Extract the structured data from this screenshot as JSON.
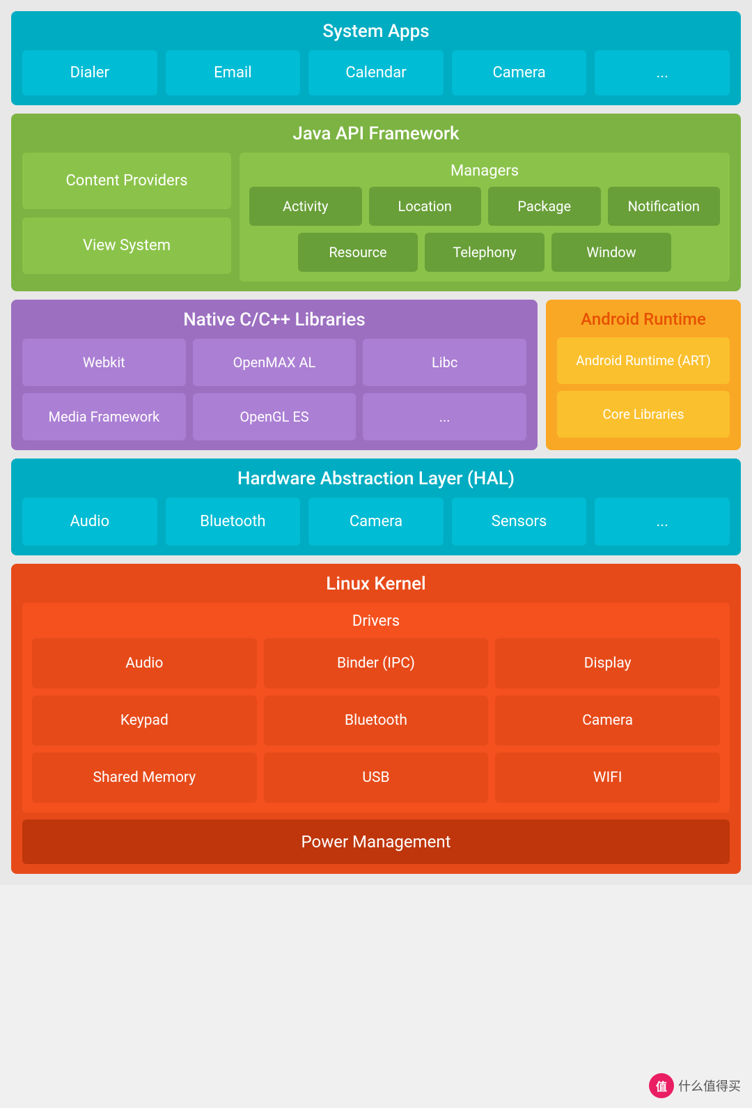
{
  "systemApps": {
    "title": "System Apps",
    "items": [
      "Dialer",
      "Email",
      "Calendar",
      "Camera",
      "..."
    ]
  },
  "javaApi": {
    "title": "Java API Framework",
    "leftItems": [
      "Content Providers",
      "View System"
    ],
    "managers": {
      "title": "Managers",
      "row1": [
        "Activity",
        "Location",
        "Package",
        "Notification"
      ],
      "row2": [
        "Resource",
        "Telephony",
        "Window"
      ]
    }
  },
  "nativeLibs": {
    "title": "Native C/C++ Libraries",
    "items": [
      "Webkit",
      "OpenMAX AL",
      "Libc",
      "Media Framework",
      "OpenGL ES",
      "..."
    ]
  },
  "androidRuntime": {
    "title": "Android Runtime",
    "items": [
      "Android Runtime (ART)",
      "Core Libraries"
    ]
  },
  "hal": {
    "title": "Hardware Abstraction Layer (HAL)",
    "items": [
      "Audio",
      "Bluetooth",
      "Camera",
      "Sensors",
      "..."
    ]
  },
  "linuxKernel": {
    "title": "Linux Kernel",
    "drivers": {
      "title": "Drivers",
      "items": [
        "Audio",
        "Binder (IPC)",
        "Display",
        "Keypad",
        "Bluetooth",
        "Camera",
        "Shared Memory",
        "USB",
        "WIFI"
      ]
    },
    "powerManagement": "Power Management"
  },
  "watermark": {
    "icon": "值",
    "text": "什么值得买"
  }
}
